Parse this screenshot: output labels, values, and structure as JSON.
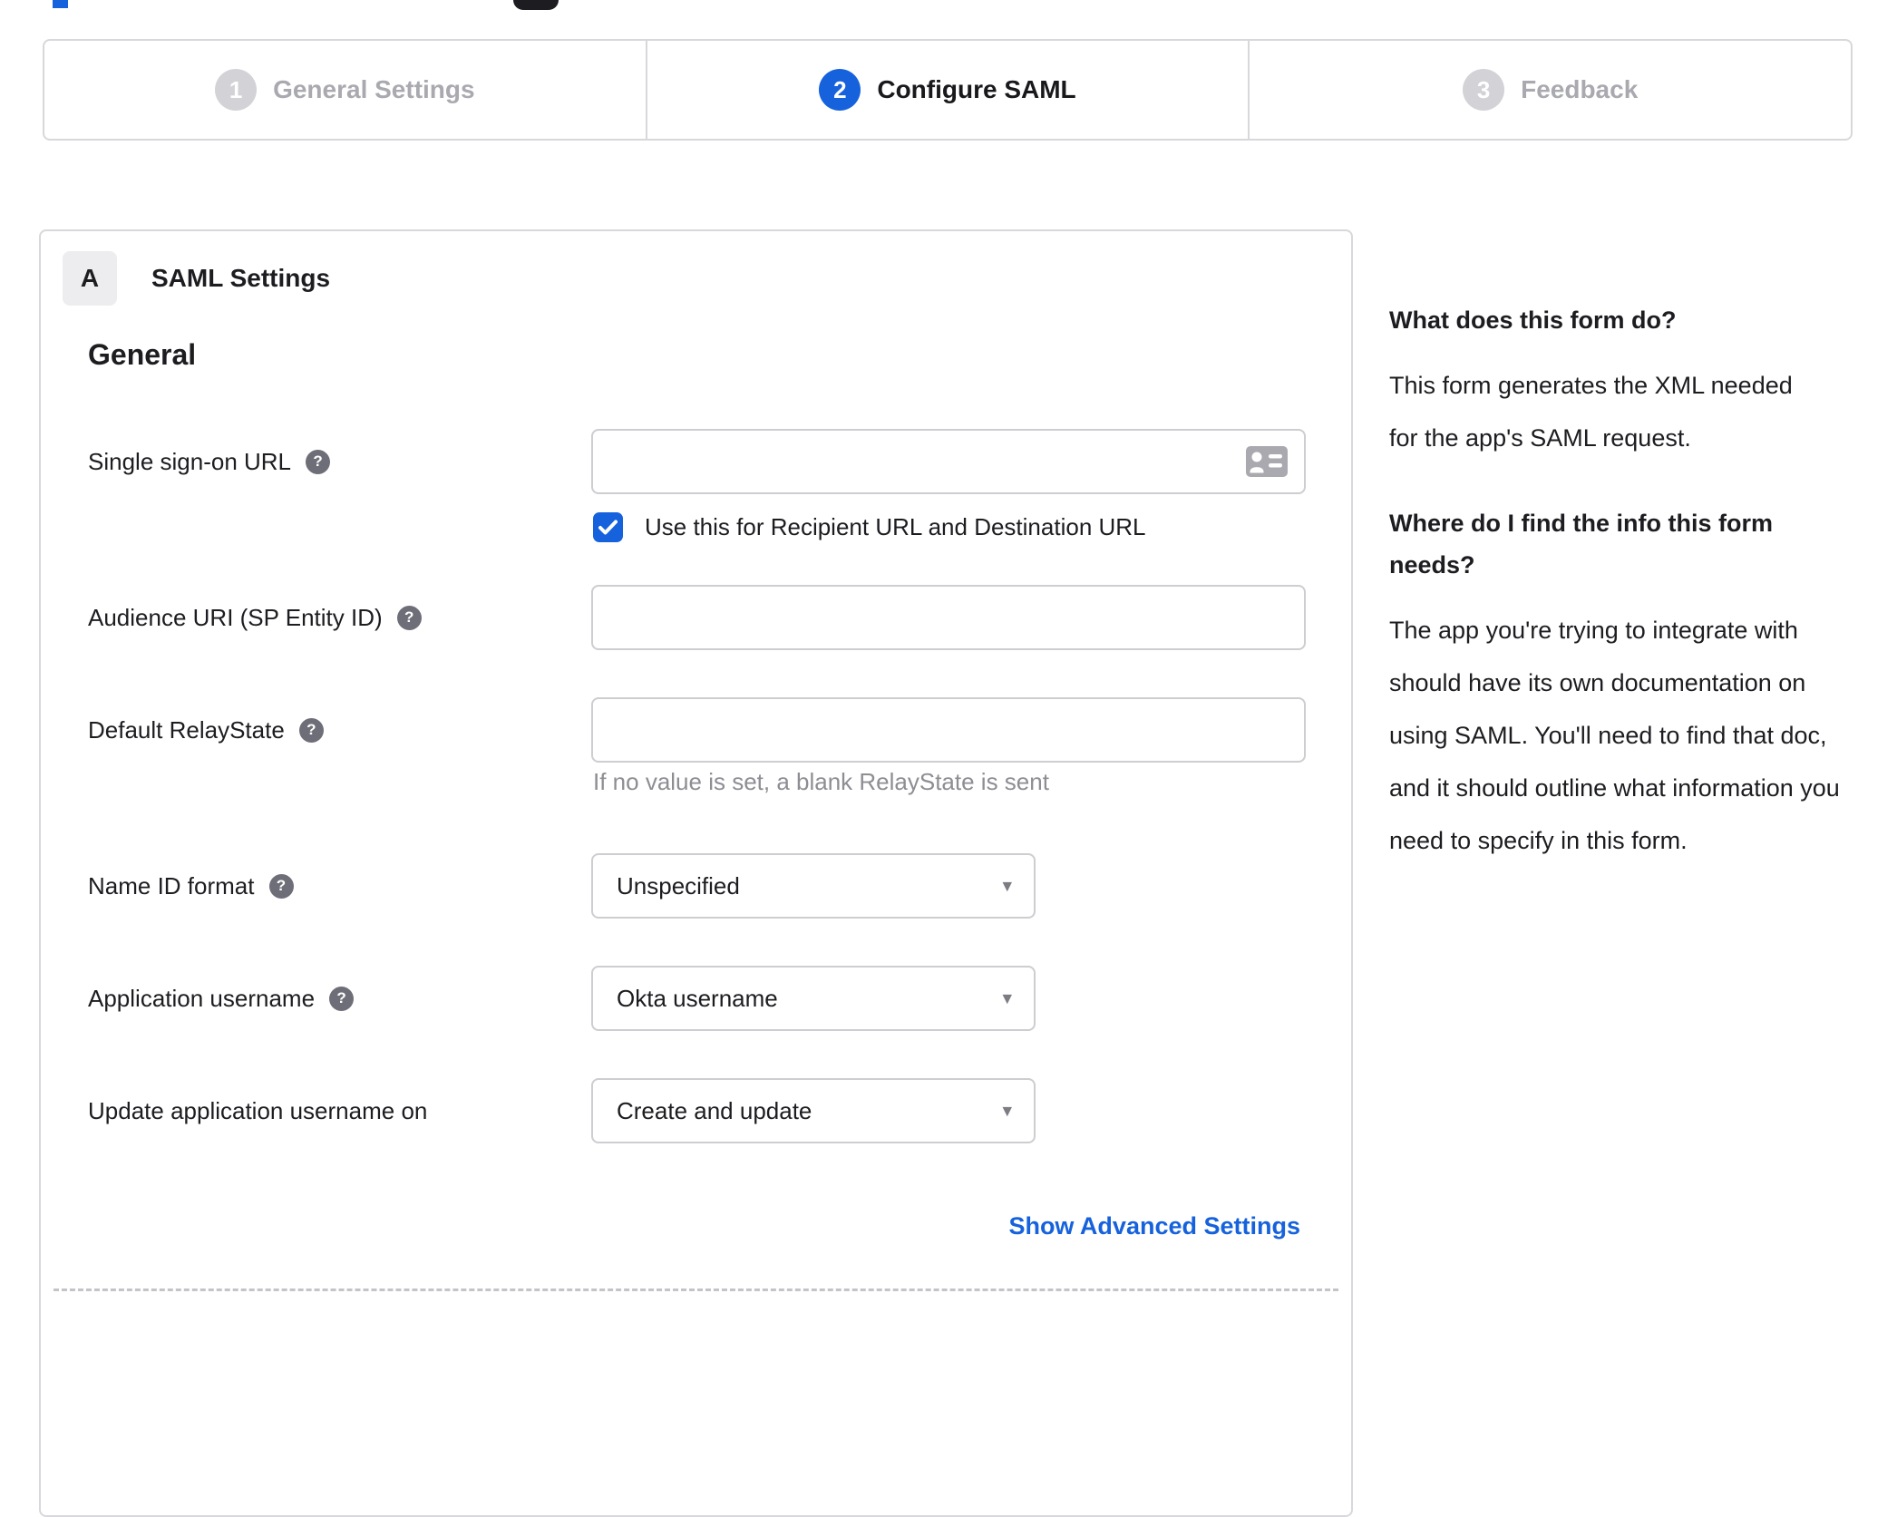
{
  "colors": {
    "accent_blue": "#1662dd",
    "inactive_gray": "#d2d2d7",
    "link_blue": "#1662dd"
  },
  "icons": {
    "help_glyph": "?",
    "caret_glyph": "▾"
  },
  "stepper": {
    "steps": [
      {
        "number": "1",
        "label": "General Settings",
        "state": "inactive"
      },
      {
        "number": "2",
        "label": "Configure SAML",
        "state": "active"
      },
      {
        "number": "3",
        "label": "Feedback",
        "state": "inactive"
      }
    ]
  },
  "panel": {
    "badge": "A",
    "title": "SAML Settings",
    "section_heading": "General",
    "fields": [
      {
        "label": "Single sign-on URL",
        "type": "text",
        "value": "",
        "checkbox_checked": true,
        "checkbox_label": "Use this for Recipient URL and Destination URL"
      },
      {
        "label": "Audience URI (SP Entity ID)",
        "type": "text",
        "value": ""
      },
      {
        "label": "Default RelayState",
        "type": "text",
        "value": "",
        "hint": "If no value is set, a blank RelayState is sent"
      },
      {
        "label": "Name ID format",
        "type": "select",
        "value": "Unspecified"
      },
      {
        "label": "Application username",
        "type": "select",
        "value": "Okta username"
      },
      {
        "label": "Update application username on",
        "type": "select",
        "value": "Create and update"
      }
    ],
    "advanced_settings_link": "Show Advanced Settings"
  },
  "help_sidebar": {
    "blocks": [
      {
        "heading": "What does this form do?",
        "body": "This form generates the XML needed for the app's SAML request."
      },
      {
        "heading": "Where do I find the info this form needs?",
        "body": "The app you're trying to integrate with should have its own documentation on using SAML. You'll need to find that doc, and it should outline what information you need to specify in this form."
      }
    ]
  }
}
